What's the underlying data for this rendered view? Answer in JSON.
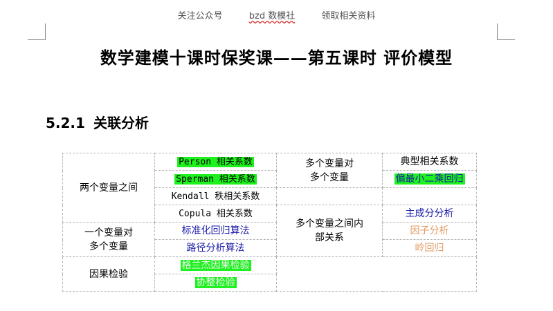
{
  "header": {
    "item1": "关注公众号",
    "item2": "bzd 数模社",
    "item3": "领取相关资料"
  },
  "document": {
    "title": "数学建模十课时保奖课——第五课时  评价模型",
    "section_number": "5.2.1",
    "section_title": "关联分析"
  },
  "table": {
    "group_two_vars": "两个变量之间",
    "person": "Person 相关系数",
    "sperman": "Sperman 相关系数",
    "kendall": "Kendall 秩相关系数",
    "copula": "Copula 相关系数",
    "group_one_to_many_line1": "一个变量对",
    "group_one_to_many_line2": "多个变量",
    "std_regression": "标准化回归算法",
    "path_analysis": "路径分析算法",
    "group_causal": "因果检验",
    "granger": "格兰杰因果检验",
    "cointegration": "协整检验",
    "many_to_many_line1": "多个变量对",
    "many_to_many_line2": "多个变量",
    "canonical_corr": "典型相关系数",
    "pls_regression": "偏最小二乘回归",
    "internal_line1": "多个变量之间内",
    "internal_line2": "部关系",
    "pca": "主成分分析",
    "factor": "因子分析",
    "ridge": "岭回归"
  }
}
